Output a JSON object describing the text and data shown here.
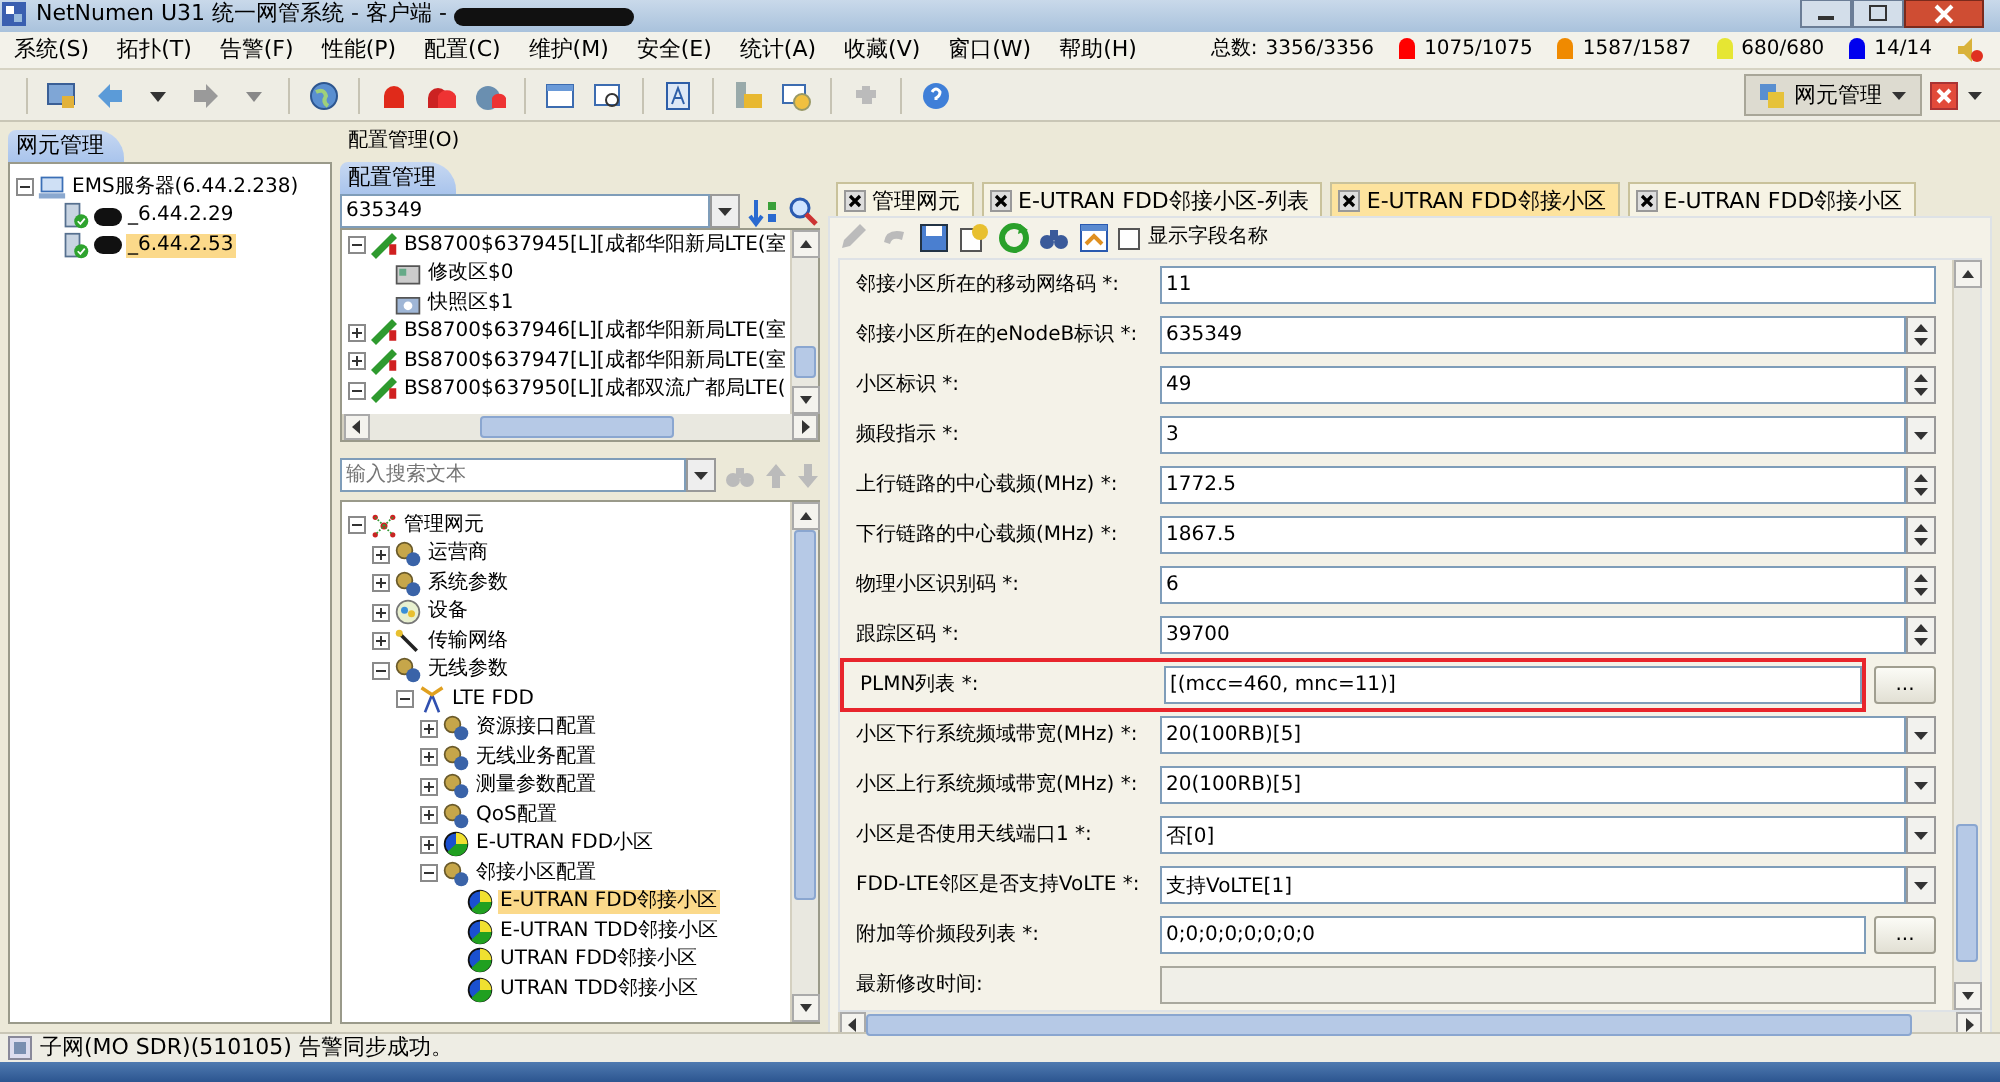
{
  "window": {
    "title": "NetNumen U31 统一网管系统 - 客户端 -"
  },
  "menu": [
    "系统(S)",
    "拓扑(T)",
    "告警(F)",
    "性能(P)",
    "配置(C)",
    "维护(M)",
    "安全(E)",
    "统计(A)",
    "收藏(V)",
    "窗口(W)",
    "帮助(H)"
  ],
  "alarm_summary": {
    "label": "总数:",
    "total": "3356/3356",
    "levels": [
      {
        "count": "1075/1075",
        "color": "#ff0000"
      },
      {
        "count": "1587/1587",
        "color": "#f08a00"
      },
      {
        "count": "680/680",
        "color": "#e6e633"
      },
      {
        "count": "14/14",
        "color": "#0000ee"
      }
    ]
  },
  "perspective_button": {
    "label": "网元管理"
  },
  "left_panel": {
    "tab": "网元管理",
    "tree": [
      {
        "label": "EMS服务器(6.44.2.238)",
        "kind": "server",
        "expanded": true,
        "children": [
          {
            "label": "_6.44.2.29",
            "kind": "ne",
            "redacted": true,
            "selected": false
          },
          {
            "label": "_6.44.2.53",
            "kind": "ne",
            "redacted": true,
            "selected": true
          }
        ]
      }
    ]
  },
  "config_panel": {
    "header": "配置管理(O)",
    "tab": "配置管理",
    "filter_value": "635349",
    "station_tree": [
      {
        "label": "BS8700$637945[L][成都华阳新局LTE(室",
        "kind": "station",
        "expanded": true,
        "children": [
          {
            "label": "修改区$0",
            "kind": "area"
          },
          {
            "label": "快照区$1",
            "kind": "snapshot"
          }
        ]
      },
      {
        "label": "BS8700$637946[L][成都华阳新局LTE(室",
        "kind": "station",
        "expanded": false
      },
      {
        "label": "BS8700$637947[L][成都华阳新局LTE(室",
        "kind": "station",
        "expanded": false
      },
      {
        "label": "BS8700$637950[L][成都双流广都局LTE(",
        "kind": "station",
        "expanded": true
      }
    ],
    "search": {
      "placeholder": "输入搜索文本"
    },
    "object_tree": [
      {
        "label": "管理网元",
        "kind": "root",
        "expanded": true,
        "children": [
          {
            "label": "运营商",
            "kind": "group",
            "expanded": false
          },
          {
            "label": "系统参数",
            "kind": "group",
            "expanded": false
          },
          {
            "label": "设备",
            "kind": "device",
            "expanded": false
          },
          {
            "label": "传输网络",
            "kind": "wand",
            "expanded": false
          },
          {
            "label": "无线参数",
            "kind": "group",
            "expanded": true,
            "children": [
              {
                "label": "LTE FDD",
                "kind": "antenna",
                "expanded": true,
                "children": [
                  {
                    "label": "资源接口配置",
                    "kind": "group",
                    "expanded": false
                  },
                  {
                    "label": "无线业务配置",
                    "kind": "group",
                    "expanded": false
                  },
                  {
                    "label": "测量参数配置",
                    "kind": "group",
                    "expanded": false
                  },
                  {
                    "label": "QoS配置",
                    "kind": "group",
                    "expanded": false
                  },
                  {
                    "label": "E-UTRAN FDD小区",
                    "kind": "cell",
                    "expanded": false
                  },
                  {
                    "label": "邻接小区配置",
                    "kind": "group",
                    "expanded": true,
                    "children": [
                      {
                        "label": "E-UTRAN FDD邻接小区",
                        "kind": "cell",
                        "selected": true
                      },
                      {
                        "label": "E-UTRAN TDD邻接小区",
                        "kind": "cell",
                        "selected": false
                      },
                      {
                        "label": "UTRAN FDD邻接小区",
                        "kind": "cell",
                        "selected": false
                      },
                      {
                        "label": "UTRAN TDD邻接小区",
                        "kind": "cell",
                        "selected": false
                      }
                    ]
                  }
                ]
              }
            ]
          }
        ]
      }
    ]
  },
  "editor": {
    "tabs": [
      {
        "label": "管理网元",
        "selected": false
      },
      {
        "label": "E-UTRAN FDD邻接小区-列表",
        "selected": false
      },
      {
        "label": "E-UTRAN FDD邻接小区",
        "selected": true
      },
      {
        "label": "E-UTRAN FDD邻接小区",
        "selected": false
      }
    ],
    "show_field_names": {
      "label": "显示字段名称",
      "checked": false
    },
    "fields": [
      {
        "label": "邻接小区所在的移动网络码 *:",
        "value": "11",
        "kind": "text"
      },
      {
        "label": "邻接小区所在的eNodeB标识 *:",
        "value": "635349",
        "kind": "spin"
      },
      {
        "label": "小区标识 *:",
        "value": "49",
        "kind": "spin"
      },
      {
        "label": "频段指示 *:",
        "value": "3",
        "kind": "select"
      },
      {
        "label": "上行链路的中心载频(MHz) *:",
        "value": "1772.5",
        "kind": "spin"
      },
      {
        "label": "下行链路的中心载频(MHz) *:",
        "value": "1867.5",
        "kind": "spin"
      },
      {
        "label": "物理小区识别码 *:",
        "value": "6",
        "kind": "spin"
      },
      {
        "label": "跟踪区码 *:",
        "value": "39700",
        "kind": "spin"
      },
      {
        "label": "PLMN列表 *:",
        "value": "[(mcc=460, mnc=11)]",
        "kind": "browse",
        "button_label": "...",
        "highlighted": true
      },
      {
        "label": "小区下行系统频域带宽(MHz) *:",
        "value": "20(100RB)[5]",
        "kind": "select"
      },
      {
        "label": "小区上行系统频域带宽(MHz) *:",
        "value": "20(100RB)[5]",
        "kind": "select"
      },
      {
        "label": "小区是否使用天线端口1 *:",
        "value": "否[0]",
        "kind": "select"
      },
      {
        "label": "FDD-LTE邻区是否支持VoLTE *:",
        "value": "支持VoLTE[1]",
        "kind": "select"
      },
      {
        "label": "附加等价频段列表 *:",
        "value": "0;0;0;0;0;0;0;0",
        "kind": "browse",
        "button_label": "..."
      },
      {
        "label": "最新修改时间:",
        "kind": "readonly"
      }
    ]
  },
  "status_bar": {
    "message": "子网(MO SDR)(510105) 告警同步成功。"
  }
}
